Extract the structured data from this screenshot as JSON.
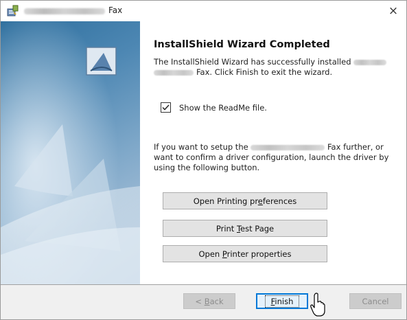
{
  "window": {
    "title_suffix": "Fax",
    "close_glyph": "×",
    "icon": "installer-icon"
  },
  "main": {
    "heading": "InstallShield Wizard Completed",
    "desc_part1": "The InstallShield Wizard has successfully installed",
    "desc_part2": "Fax. Click Finish to exit the wizard.",
    "checkbox_label": "Show the ReadMe file.",
    "checkbox_checked": true,
    "info_part1": "If you want to setup the",
    "info_part2": "Fax further, or want to confirm a driver configuration, launch the driver by using the following button."
  },
  "buttons": {
    "printing_pre": "Open Printing pr",
    "printing_ul": "e",
    "printing_post": "ferences",
    "test_pre": "Print ",
    "test_ul": "T",
    "test_post": "est Page",
    "props_pre": "Open ",
    "props_ul": "P",
    "props_post": "rinter properties"
  },
  "nav": {
    "back_pre": "< ",
    "back_ul": "B",
    "back_post": "ack",
    "finish_ul": "F",
    "finish_post": "inish",
    "cancel": "Cancel"
  },
  "colors": {
    "accent": "#0078d7",
    "bottom_bar": "#f0f0f0"
  }
}
